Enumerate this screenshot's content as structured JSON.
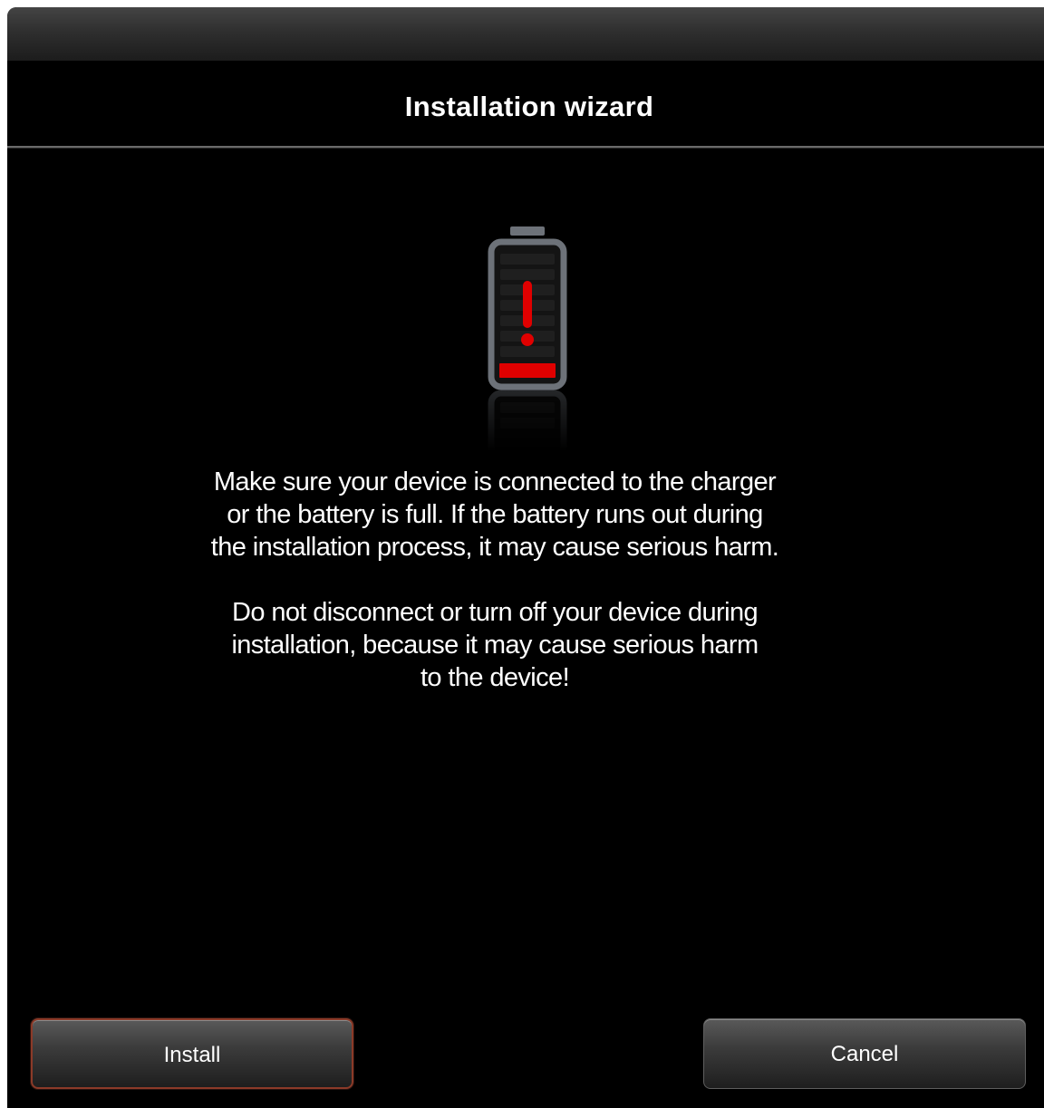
{
  "window": {
    "title": "Installation wizard"
  },
  "battery_icon": {
    "name": "battery-low-warning-icon",
    "accent_color": "#e00000",
    "frame_color": "#6d7279"
  },
  "message": {
    "paragraph_1": [
      "Make sure your device is connected to the charger",
      "or the battery is full. If the battery runs out during",
      "the installation process, it may cause serious harm."
    ],
    "paragraph_2": [
      "Do not disconnect or turn off your device during",
      "installation, because it may cause serious harm",
      "to the device!"
    ]
  },
  "buttons": {
    "install_label": "Install",
    "cancel_label": "Cancel",
    "install_border_color": "#8b3a28"
  }
}
